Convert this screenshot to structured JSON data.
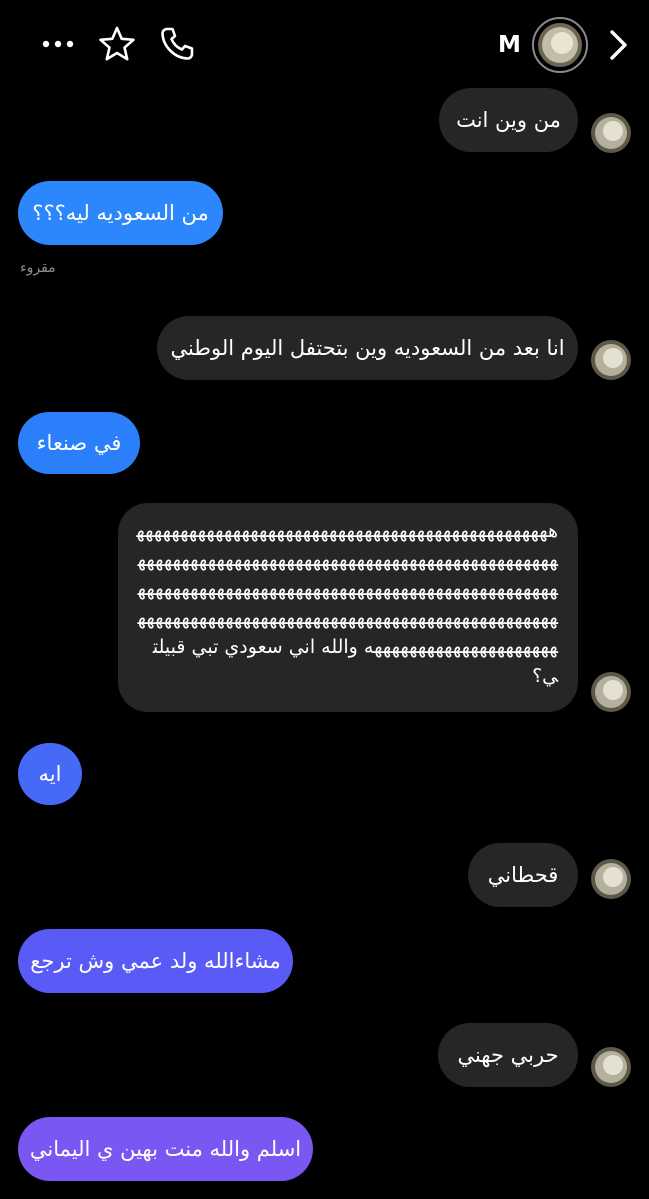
{
  "header": {
    "contact_name": "M",
    "more_icon": "more-horizontal-icon",
    "star_icon": "star-icon",
    "call_icon": "phone-icon",
    "back_icon": "chevron-right-icon"
  },
  "colors": {
    "background": "#000000",
    "incoming_bubble": "#262626",
    "outgoing_gradient_start": "#2c86fc",
    "outgoing_gradient_end": "#7a56f2",
    "seen_text": "#8e8e8e"
  },
  "messages": [
    {
      "direction": "incoming",
      "text": "من وين انت"
    },
    {
      "direction": "outgoing",
      "text": "من السعوديه ليه؟؟؟"
    },
    {
      "direction": "incoming",
      "text": "انا بعد من السعوديه وين بتحتفل اليوم الوطني"
    },
    {
      "direction": "outgoing",
      "text": "في صنعاء"
    },
    {
      "direction": "incoming",
      "text": "هههههههههههههههههههههههههههههههههههههههههههههههههههههههههههههههههههههههههههههههههههههههههههههههههههههههههههههههههههههههههههههههههههههههههههههههههههههههههههههههههههههههههههههههههههههههههههههههههههههههههههههههههههههه والله اني سعودي تبي قبيلتي؟"
    },
    {
      "direction": "outgoing",
      "text": "ايه"
    },
    {
      "direction": "incoming",
      "text": "قحطاني"
    },
    {
      "direction": "outgoing",
      "text": "مشاءالله ولد عمي وش ترجع"
    },
    {
      "direction": "incoming",
      "text": "حربي جهني"
    },
    {
      "direction": "outgoing",
      "text": "اسلم والله منت بهين ي اليماني"
    }
  ],
  "seen_label": "مقروء"
}
